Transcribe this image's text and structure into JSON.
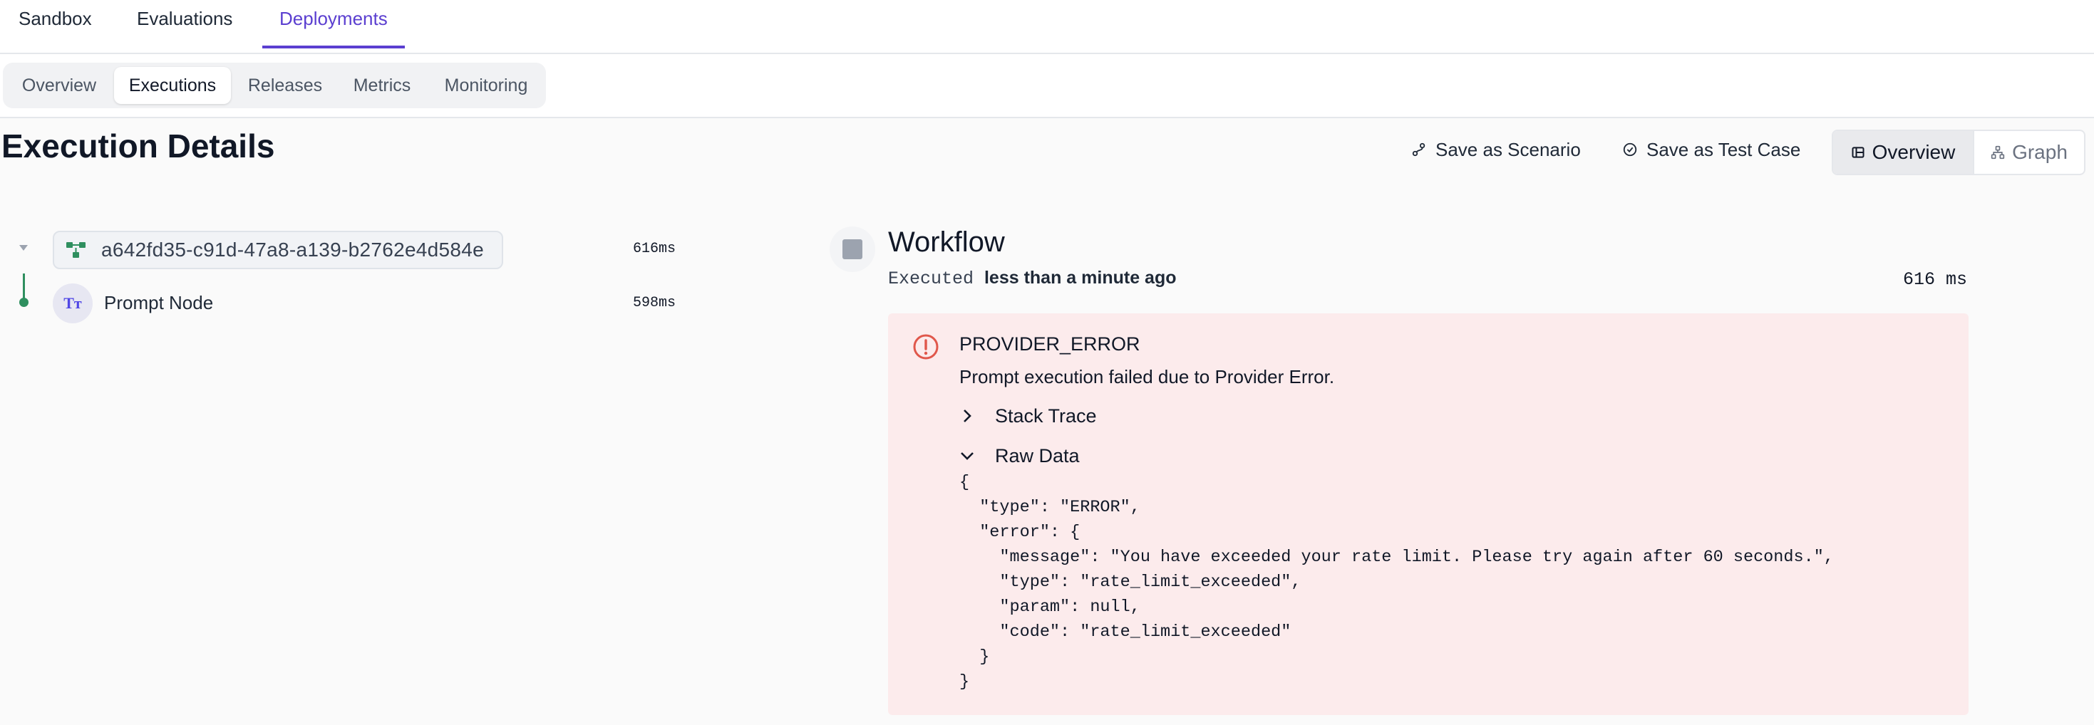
{
  "top_tabs": [
    {
      "label": "Sandbox",
      "active": false
    },
    {
      "label": "Evaluations",
      "active": false
    },
    {
      "label": "Deployments",
      "active": true
    }
  ],
  "sub_tabs": [
    {
      "label": "Overview",
      "active": false
    },
    {
      "label": "Executions",
      "active": true
    },
    {
      "label": "Releases",
      "active": false
    },
    {
      "label": "Metrics",
      "active": false
    },
    {
      "label": "Monitoring",
      "active": false
    }
  ],
  "header": {
    "title": "Execution Details",
    "save_scenario": "Save as Scenario",
    "save_test_case": "Save as Test Case",
    "view_overview": "Overview",
    "view_graph": "Graph",
    "active_view": "Overview"
  },
  "tree": {
    "root": {
      "id": "a642fd35-c91d-47a8-a139-b2762e4d584e",
      "duration": "616ms",
      "icon": "workflow-icon"
    },
    "children": [
      {
        "label": "Prompt Node",
        "duration": "598ms",
        "icon": "text-type-icon",
        "avatar_text": "Tт"
      }
    ]
  },
  "detail": {
    "title": "Workflow",
    "executed_label": "Executed",
    "executed_time": "less than a minute ago",
    "duration": "616 ms",
    "error": {
      "code": "PROVIDER_ERROR",
      "message": "Prompt execution failed due to Provider Error.",
      "stack_trace_label": "Stack Trace",
      "stack_trace_expanded": false,
      "raw_data_label": "Raw Data",
      "raw_data_expanded": true,
      "raw_data": "{\n  \"type\": \"ERROR\",\n  \"error\": {\n    \"message\": \"You have exceeded your rate limit. Please try again after 60 seconds.\",\n    \"type\": \"rate_limit_exceeded\",\n    \"param\": null,\n    \"code\": \"rate_limit_exceeded\"\n  }\n}"
    }
  },
  "colors": {
    "accent": "#5b3fd0",
    "error_bg": "#fcebec",
    "error_icon": "#e0574b",
    "node_line": "#2f8f5f"
  }
}
